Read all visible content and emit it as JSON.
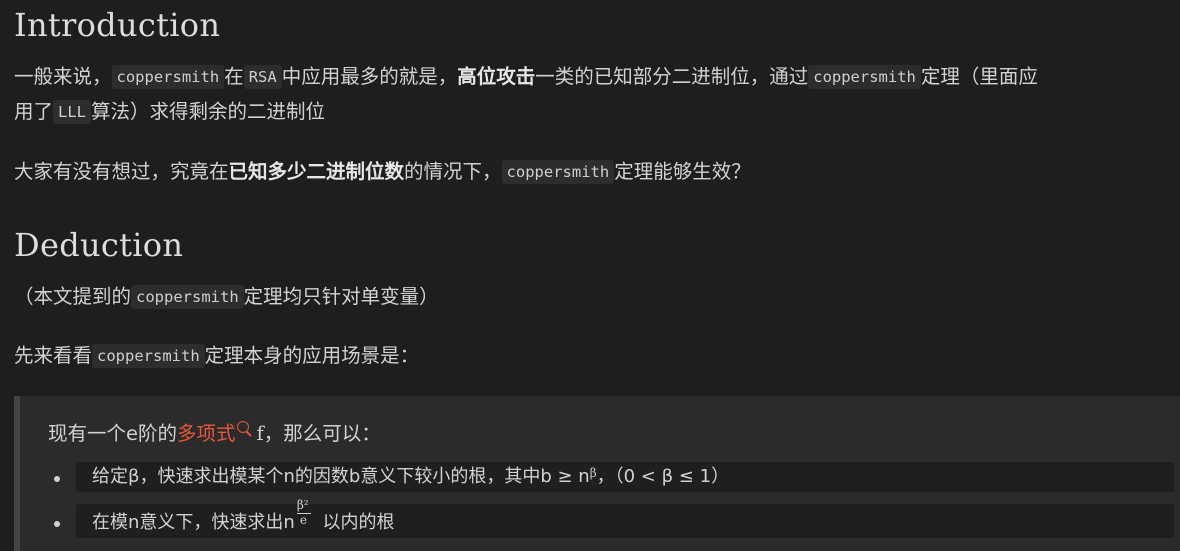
{
  "intro": {
    "heading": "Introduction",
    "p1_a": "一般来说，",
    "p1_code1": "coppersmith",
    "p1_b": "在",
    "p1_code2": "RSA",
    "p1_c": "中应用最多的就是，",
    "p1_bold": "高位攻击",
    "p1_d": "一类的已知部分二进制位，通过",
    "p1_code3": "coppersmith",
    "p1_e": "定理（里面应",
    "p1b_a": "用了",
    "p1b_code": "LLL",
    "p1b_b": "算法）求得剩余的二进制位",
    "p2_a": "大家有没有想过，究竟在",
    "p2_bold": "已知多少二进制位数",
    "p2_b": "的情况下，",
    "p2_code": "coppersmith",
    "p2_c": "定理能够生效？"
  },
  "deduction": {
    "heading": "Deduction",
    "p3_a": "（本文提到的",
    "p3_code": "coppersmith",
    "p3_b": "定理均只针对单变量）",
    "p4_a": "先来看看",
    "p4_code": "coppersmith",
    "p4_b": "定理本身的应用场景是："
  },
  "quote": {
    "line_a": "现有一个e阶的",
    "link": "多项式",
    "search_icon": "search-icon",
    "line_f": "f",
    "line_b": "，那么可以：",
    "li1_a": "给定β，快速求出模某个n的因数b意义下较小的根，其中b ≥ n",
    "li1_sup": "β",
    "li1_b": "，（0 < β ≤ 1）",
    "li2_a": "在模n意义下，快速求出n",
    "li2_num": "β²",
    "li2_den": "e",
    "li2_b": " 以内的根"
  },
  "colors": {
    "background": "#1e1e1e",
    "link": "#e8563a",
    "code_bg": "#2d2d2d",
    "quote_bg": "#2b2b2b"
  }
}
